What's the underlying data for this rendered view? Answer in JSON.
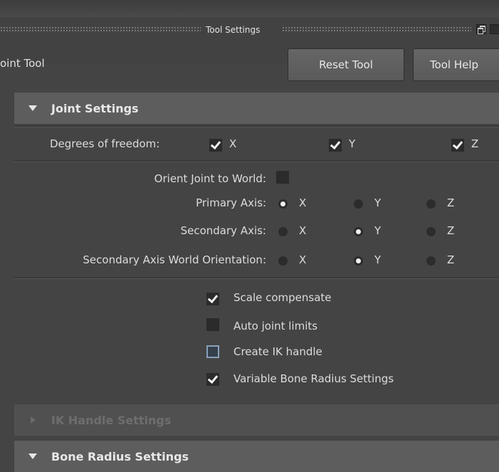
{
  "window": {
    "title": "Tool Settings",
    "tool_name": "oint Tool"
  },
  "buttons": {
    "reset": "Reset Tool",
    "help": "Tool Help"
  },
  "joint_settings": {
    "header": "Joint Settings",
    "degrees_label": "Degrees of freedom:",
    "dof": [
      {
        "axis": "X",
        "checked": true
      },
      {
        "axis": "Y",
        "checked": true
      },
      {
        "axis": "Z",
        "checked": true
      }
    ],
    "orient_label": "Orient Joint to World:",
    "orient_checked": false,
    "primary_label": "Primary Axis:",
    "primary_selected": "X",
    "secondary_label": "Secondary Axis:",
    "secondary_selected": "Y",
    "secondary_world_label": "Secondary Axis World Orientation:",
    "secondary_world_selected": "Y",
    "axes": [
      "X",
      "Y",
      "Z"
    ],
    "options": [
      {
        "label": "Scale compensate",
        "state": "checked"
      },
      {
        "label": "Auto joint limits",
        "state": "unchecked"
      },
      {
        "label": "Create IK handle",
        "state": "unchecked-highlight"
      },
      {
        "label": "Variable Bone Radius Settings",
        "state": "checked"
      }
    ]
  },
  "ik_handle_settings": {
    "header": "IK Handle Settings"
  },
  "bone_radius_settings": {
    "header": "Bone Radius Settings"
  },
  "icons": [
    "restore-icon",
    "close-icon",
    "expand-arrow-icon",
    "collapse-arrow-icon",
    "checkmark-icon",
    "radio-icon"
  ]
}
